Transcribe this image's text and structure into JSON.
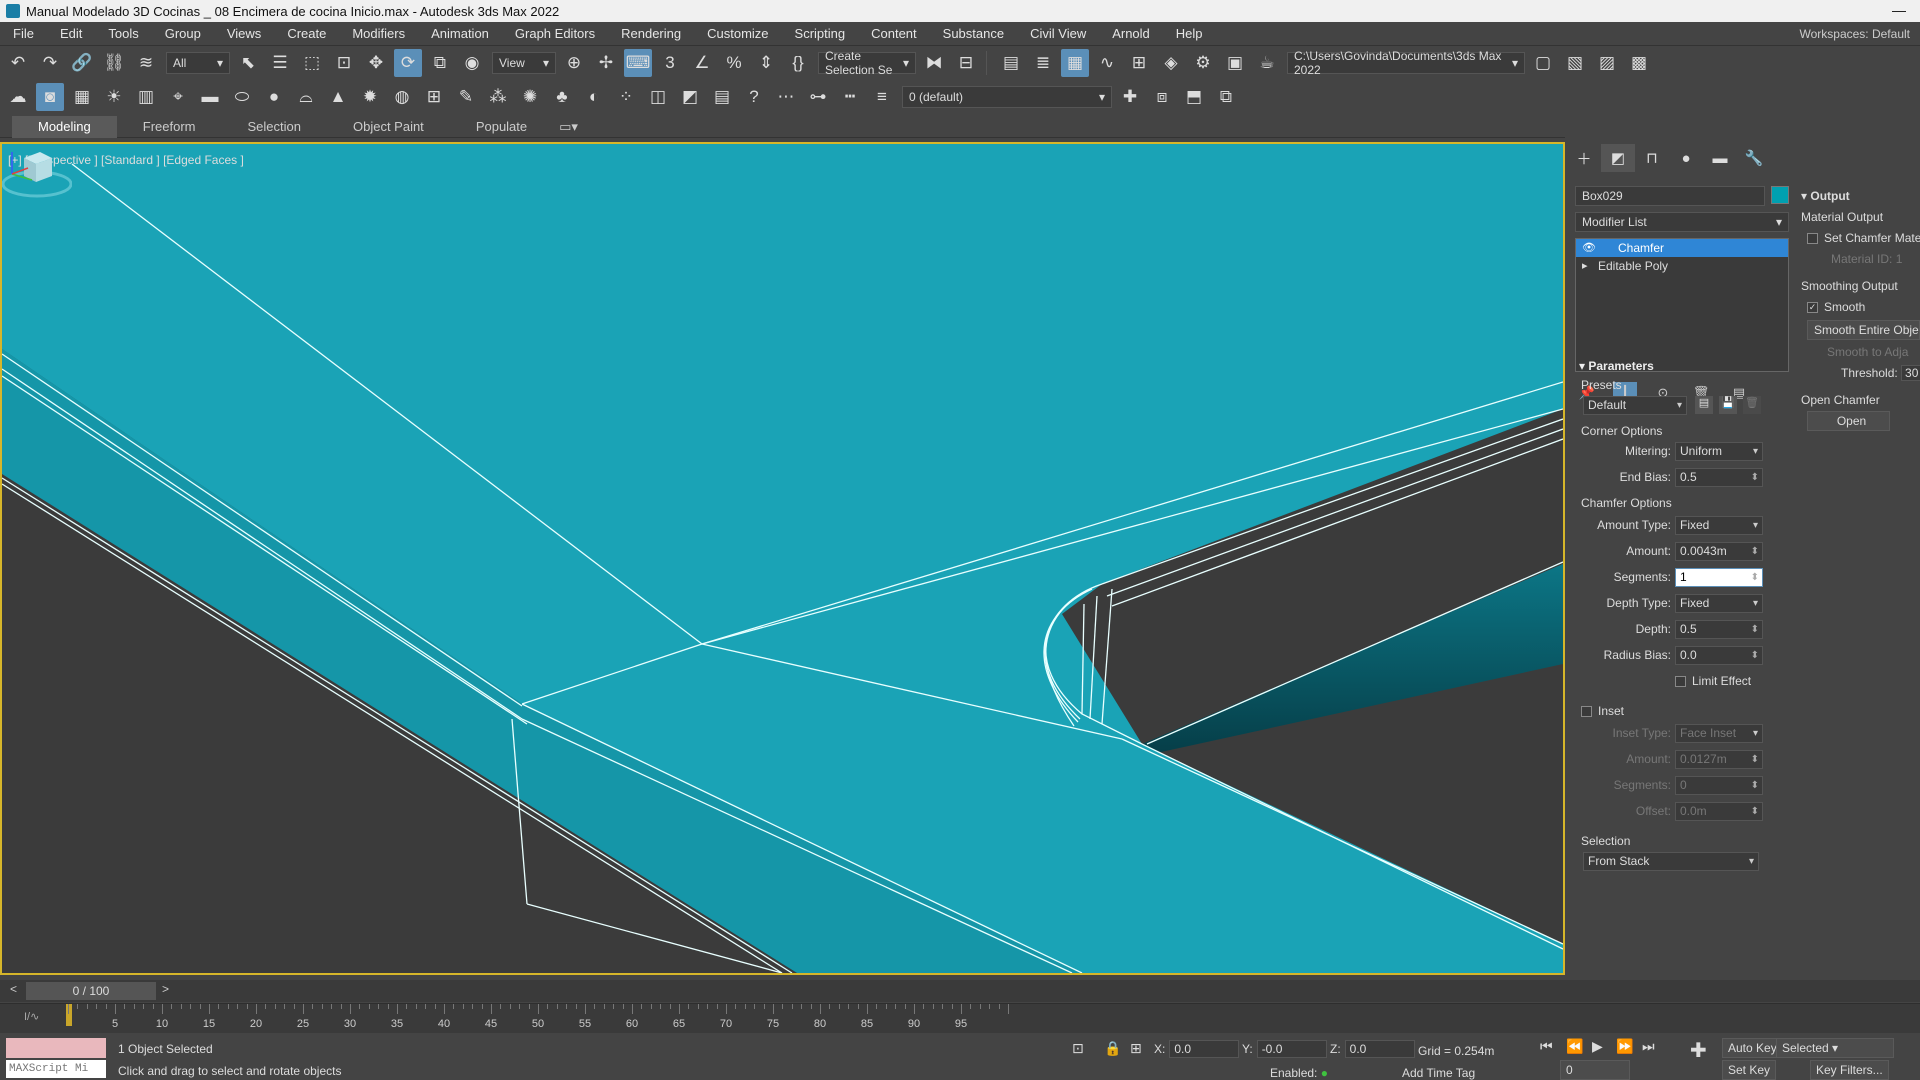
{
  "window": {
    "title": "Manual Modelado 3D Cocinas _ 08 Encimera de cocina Inicio.max - Autodesk 3ds Max 2022",
    "close_glyph": "—"
  },
  "menu": [
    "File",
    "Edit",
    "Tools",
    "Group",
    "Views",
    "Create",
    "Modifiers",
    "Animation",
    "Graph Editors",
    "Rendering",
    "Customize",
    "Scripting",
    "Content",
    "Substance",
    "Civil View",
    "Arnold",
    "Help"
  ],
  "workspace": "Workspaces:   Default",
  "toolbar": {
    "selection_filter": "All",
    "ref_coord": "View",
    "named_selection": "Create Selection Se",
    "project_path": "C:\\Users\\Govinda\\Documents\\3ds Max 2022",
    "layer": "0 (default)"
  },
  "ribbon": {
    "tabs": [
      "Modeling",
      "Freeform",
      "Selection",
      "Object Paint",
      "Populate"
    ],
    "active": "Modeling"
  },
  "viewport": {
    "label": "[+] [Perspective ] [Standard ] [Edged Faces ]",
    "surface_color": "#1aa3b6",
    "wire_color": "#e8ffff"
  },
  "command_panel": {
    "object_name": "Box029",
    "object_color": "#00a0b0",
    "modifier_list": "Modifier List",
    "stack": [
      {
        "label": "Chamfer",
        "selected": true
      },
      {
        "label": "Editable Poly",
        "selected": false
      }
    ],
    "parameters": {
      "title": "Parameters",
      "presets_label": "Presets",
      "preset_value": "Default",
      "corner_options": "Corner Options",
      "mitering_label": "Mitering:",
      "mitering_value": "Uniform",
      "end_bias_label": "End Bias:",
      "end_bias_value": "0.5",
      "chamfer_options": "Chamfer Options",
      "amount_type_label": "Amount Type:",
      "amount_type_value": "Fixed",
      "amount_label": "Amount:",
      "amount_value": "0.0043m",
      "segments_label": "Segments:",
      "segments_value": "1",
      "depth_type_label": "Depth Type:",
      "depth_type_value": "Fixed",
      "depth_label": "Depth:",
      "depth_value": "0.5",
      "radius_bias_label": "Radius Bias:",
      "radius_bias_value": "0.0",
      "limit_effect": "Limit Effect",
      "inset": "Inset",
      "inset_type_label": "Inset Type:",
      "inset_type_value": "Face Inset",
      "inset_amount_label": "Amount:",
      "inset_amount_value": "0.0127m",
      "inset_segments_label": "Segments:",
      "inset_segments_value": "0",
      "offset_label": "Offset:",
      "offset_value": "0.0m",
      "selection_label": "Selection",
      "selection_value": "From Stack"
    },
    "output": {
      "title": "Output",
      "material_output": "Material Output",
      "set_chamfer_mat": "Set Chamfer Mater",
      "material_id_label": "Material ID:",
      "material_id_value": "1",
      "smoothing_output": "Smoothing Output",
      "smooth": "Smooth",
      "smooth_entire": "Smooth Entire Object",
      "smooth_adjacent": "Smooth to Adja",
      "threshold_label": "Threshold:",
      "threshold_value": "30",
      "open_chamfer": "Open Chamfer",
      "open_button": "Open"
    }
  },
  "timeline": {
    "frame_display": "0 / 100",
    "ticks": [
      "5",
      "10",
      "15",
      "20",
      "25",
      "30",
      "35",
      "40",
      "45",
      "50",
      "55",
      "60",
      "65",
      "70",
      "75",
      "80",
      "85",
      "90",
      "95"
    ]
  },
  "status": {
    "maxscript_placeholder": "MAXScript Mi",
    "selected_text": "1 Object Selected",
    "prompt_text": "Click and drag to select and rotate objects",
    "x_label": "X:",
    "x_value": "0.0",
    "y_label": "Y:",
    "y_value": "-0.0",
    "z_label": "Z:",
    "z_value": "0.0",
    "grid": "Grid = 0.254m",
    "enabled": "Enabled:",
    "add_time_tag": "Add Time Tag",
    "auto_key": "Auto Key",
    "set_key": "Set Key",
    "selected_dropdown": "Selected",
    "key_filters": "Key Filters...",
    "frame_field": "0"
  }
}
